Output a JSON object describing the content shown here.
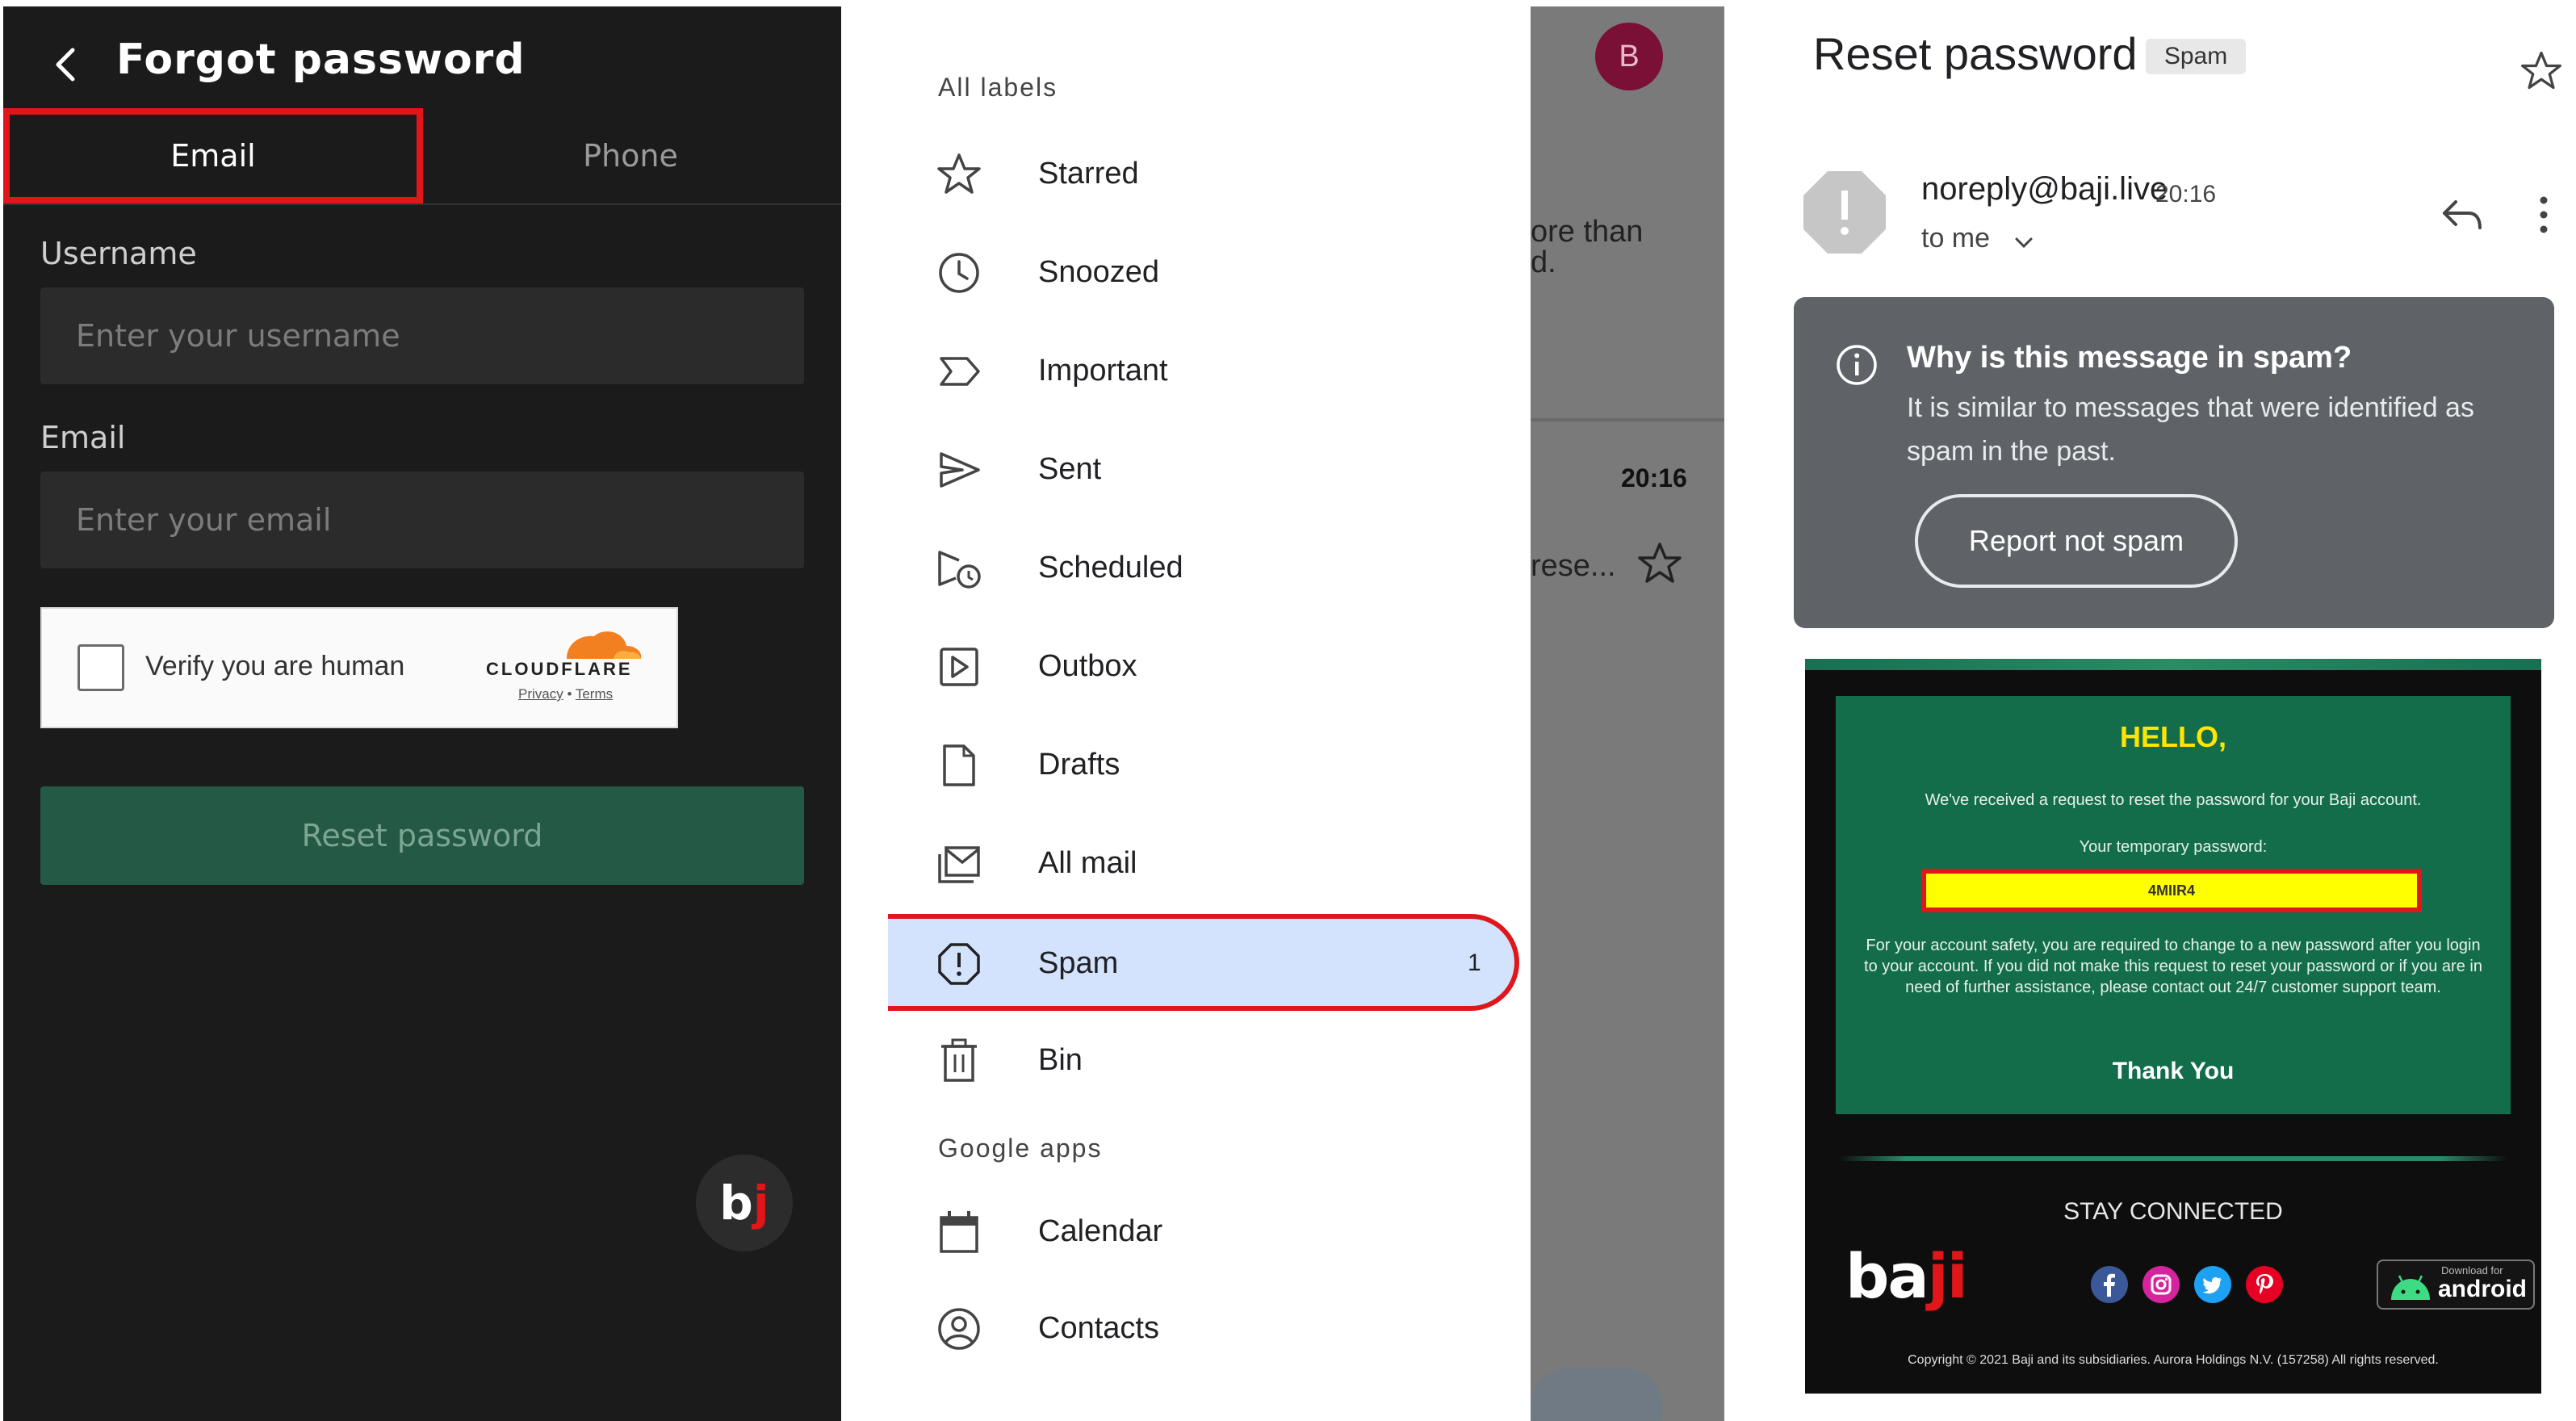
{
  "forgot_password": {
    "title": "Forgot password",
    "tabs": [
      {
        "label": "Email",
        "selected": true
      },
      {
        "label": "Phone",
        "selected": false
      }
    ],
    "username_label": "Username",
    "username_placeholder": "Enter your username",
    "email_label": "Email",
    "email_placeholder": "Enter your email",
    "captcha": {
      "text": "Verify you are human",
      "brand": "CLOUDFLARE",
      "privacy": "Privacy",
      "separator": "•",
      "terms": "Terms"
    },
    "reset_button": "Reset password",
    "logo_b": "b",
    "logo_j": "j",
    "colors": {
      "highlight": "#e0161b",
      "reset_button_bg": "#235945",
      "background": "#1b1b1b"
    }
  },
  "gmail_drawer": {
    "section_labels": "All labels",
    "items": [
      {
        "label": "Starred",
        "icon": "star-icon"
      },
      {
        "label": "Snoozed",
        "icon": "clock-icon"
      },
      {
        "label": "Important",
        "icon": "important-icon"
      },
      {
        "label": "Sent",
        "icon": "send-icon"
      },
      {
        "label": "Scheduled",
        "icon": "scheduled-icon"
      },
      {
        "label": "Outbox",
        "icon": "outbox-icon"
      },
      {
        "label": "Drafts",
        "icon": "draft-icon"
      },
      {
        "label": "All mail",
        "icon": "all-mail-icon"
      },
      {
        "label": "Spam",
        "icon": "spam-icon",
        "count": "1",
        "active": true
      },
      {
        "label": "Bin",
        "icon": "trash-icon"
      }
    ],
    "section_apps": "Google apps",
    "apps": [
      {
        "label": "Calendar",
        "icon": "calendar-icon"
      },
      {
        "label": "Contacts",
        "icon": "contacts-icon"
      }
    ],
    "background": {
      "avatar_letter": "B",
      "text_line1": "ore than",
      "text_line2": "d.",
      "time": "20:16",
      "preview": "rese..."
    },
    "colors": {
      "active_bg": "#d3e3fd",
      "highlight": "#e0161b",
      "avatar_bg": "#7a1035"
    }
  },
  "email_view": {
    "subject": "Reset password",
    "tag": "Spam",
    "sender": "noreply@baji.live",
    "time": "20:16",
    "to": "to me",
    "spam_box": {
      "question": "Why is this message in spam?",
      "answer": "It is similar to messages that were identified as spam in the past.",
      "button": "Report not spam"
    },
    "mail": {
      "hello": "HELLO,",
      "line1": "We've received a request to reset the password for your Baji account.",
      "line2": "Your temporary password:",
      "password": "4MIIR4",
      "body": "For your account safety, you are required to change to a new password after you login to your account. If you did not make this request to reset your password or if you are in need of further assistance, please contact out 24/7 customer support team.",
      "thanks": "Thank You",
      "stay": "STAY CONNECTED",
      "logo_ba": "ba",
      "logo_ji": "ji",
      "android_small": "Download for",
      "android_big": "android",
      "copyright": "Copyright © 2021 Baji and its subsidiaries. Aurora Holdings N.V. (157258) All rights reserved."
    },
    "colors": {
      "mail_green": "#136d4b",
      "password_bg": "#ffff00",
      "hello": "#ffe600",
      "spam_box_bg": "#5f6368"
    }
  }
}
